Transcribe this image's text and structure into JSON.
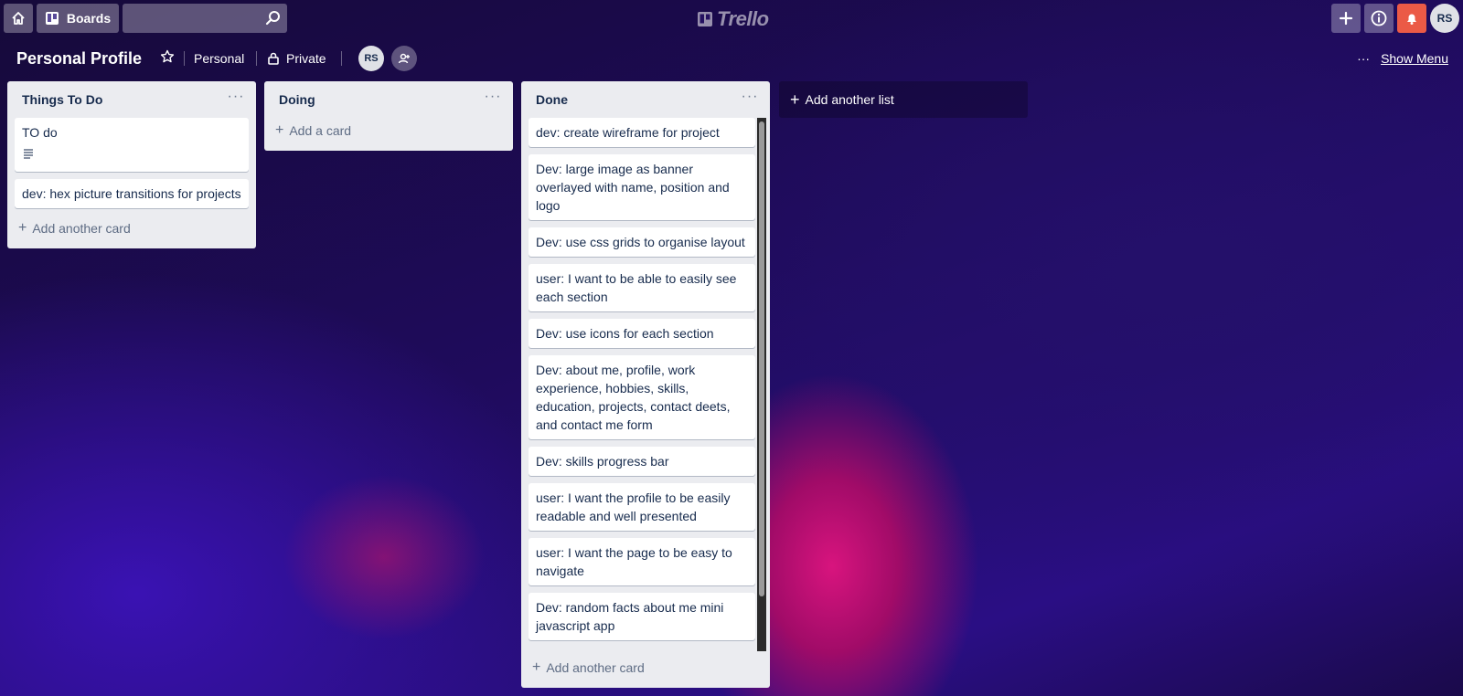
{
  "header": {
    "boards_label": "Boards",
    "search_placeholder": "",
    "logo_text": "Trello",
    "user_initials": "RS",
    "icons": [
      "home-icon",
      "boards-icon",
      "search-icon",
      "plus-icon",
      "info-icon",
      "bell-icon"
    ],
    "colors": {
      "notification": "#eb5a46"
    }
  },
  "board": {
    "title": "Personal Profile",
    "team_label": "Personal",
    "visibility_label": "Private",
    "member_initials": "RS",
    "menu_dots": "···",
    "show_menu_label": "Show Menu",
    "add_list_label": "Add another list"
  },
  "lists": [
    {
      "title": "Things To Do",
      "menu": "···",
      "cards": [
        {
          "text": "TO do",
          "has_description": true
        },
        {
          "text": "dev: hex picture transitions for projects"
        }
      ],
      "add_label": "Add another card"
    },
    {
      "title": "Doing",
      "menu": "···",
      "cards": [],
      "add_label": "Add a card"
    },
    {
      "title": "Done",
      "menu": "···",
      "cards": [
        {
          "text": "dev: create wireframe for project"
        },
        {
          "text": "Dev: large image as banner overlayed with name, position and logo"
        },
        {
          "text": "Dev: use css grids to organise layout"
        },
        {
          "text": "user: I want to be able to easily see each section"
        },
        {
          "text": "Dev: use icons for each section"
        },
        {
          "text": "Dev: about me, profile, work experience, hobbies, skills, education, projects, contact deets, and contact me form"
        },
        {
          "text": "Dev: skills progress bar"
        },
        {
          "text": "user: I want the profile to be easily readable and well presented"
        },
        {
          "text": "user: I want the page to be easy to navigate"
        },
        {
          "text": "Dev: random facts about me mini javascript app"
        }
      ],
      "add_label": "Add another card"
    }
  ]
}
